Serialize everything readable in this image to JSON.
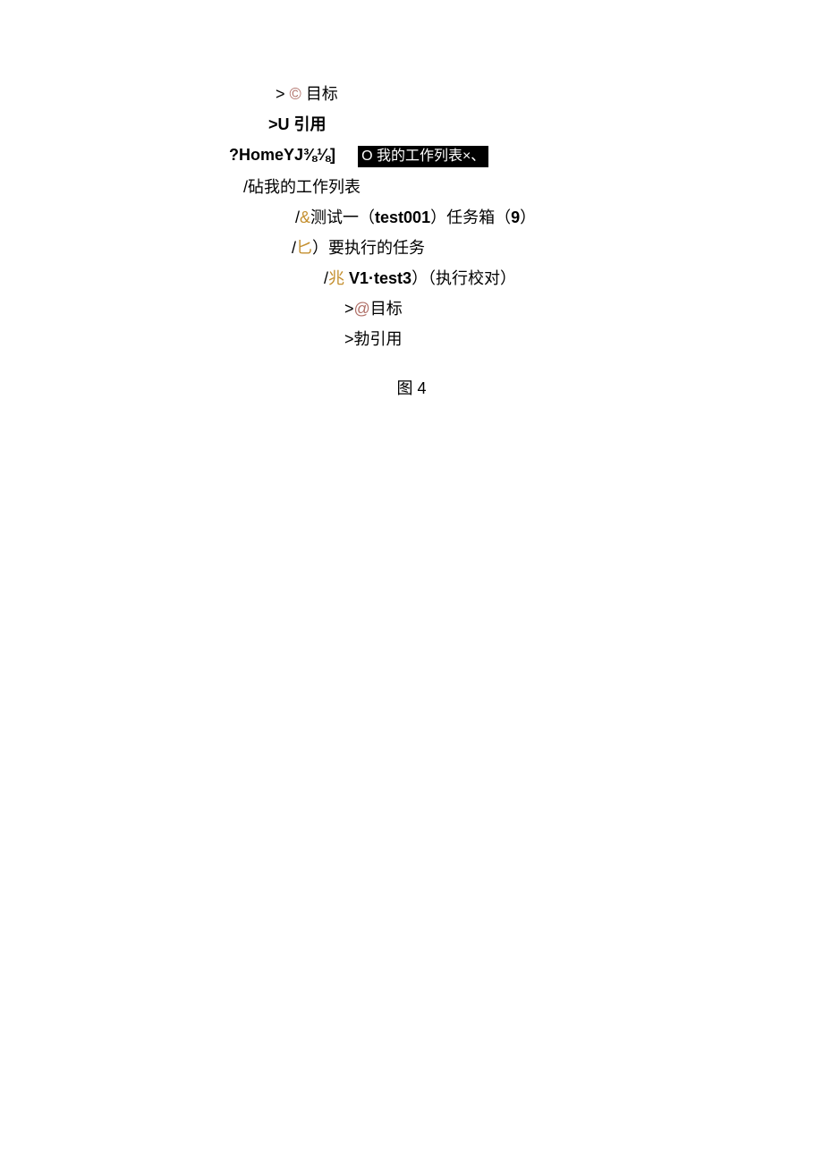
{
  "lines": {
    "l0": {
      "p": ">",
      "sym": "©",
      "t": "目标"
    },
    "l1": {
      "p": ">U ",
      "t": "引用"
    },
    "l2a": "?HomeYJ⅜⅛]",
    "l2b": "O 我的工作列表×、",
    "l3": {
      "p": "/",
      "sym": "砧",
      "t": "我的工作列表"
    },
    "l4": {
      "p": "/",
      "sym": "&",
      "t1": "测试一（",
      "b": "test001",
      "t2": "）任务箱（",
      "n": "9",
      "t3": "）"
    },
    "l5": {
      "p": "/",
      "sym": "匕",
      "t": "）要执行的任务"
    },
    "l6": {
      "p": "/",
      "sym": "兆 ",
      "b": "V1·test3",
      "t1": "）（执行校对）"
    },
    "l7": {
      "p": ">",
      "sym": "@",
      "t": "目标"
    },
    "l8": {
      "p": ">",
      "sym": "勃",
      "t": "引用"
    }
  },
  "caption": "图 4"
}
